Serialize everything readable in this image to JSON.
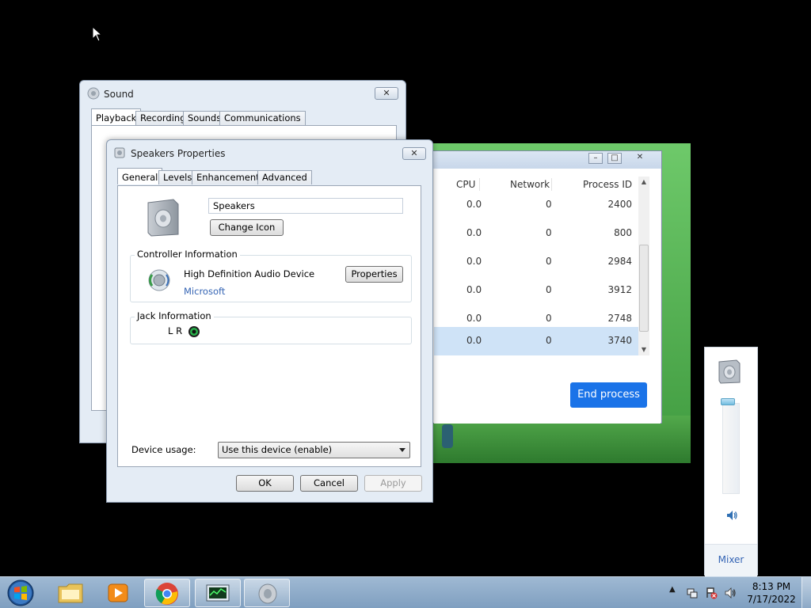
{
  "task_manager": {
    "columns": [
      "CPU",
      "Network",
      "Process ID"
    ],
    "rows": [
      {
        "cpu": "0.0",
        "network": "0",
        "pid": "2400"
      },
      {
        "cpu": "0.0",
        "network": "0",
        "pid": "800"
      },
      {
        "cpu": "0.0",
        "network": "0",
        "pid": "2984"
      },
      {
        "cpu": "0.0",
        "network": "0",
        "pid": "3912"
      },
      {
        "cpu": "0.0",
        "network": "0",
        "pid": "2748"
      },
      {
        "cpu": "0.0",
        "network": "0",
        "pid": "3740"
      }
    ],
    "selected_row_index": 5,
    "end_process_label": "End process"
  },
  "sound_dialog": {
    "title": "Sound",
    "tabs": [
      "Playback",
      "Recording",
      "Sounds",
      "Communications"
    ],
    "active_tab": "Playback",
    "close_glyph": "✕"
  },
  "speakers_dialog": {
    "title": "Speakers Properties",
    "tabs": [
      "General",
      "Levels",
      "Enhancements",
      "Advanced"
    ],
    "active_tab": "General",
    "device_name": "Speakers",
    "change_icon_label": "Change Icon",
    "controller_group_label": "Controller Information",
    "controller_name": "High Definition Audio Device",
    "controller_vendor": "Microsoft",
    "properties_label": "Properties",
    "jack_group_label": "Jack Information",
    "jack_channels": "L R",
    "device_usage_label": "Device usage:",
    "device_usage_value": "Use this device (enable)",
    "ok_label": "OK",
    "cancel_label": "Cancel",
    "apply_label": "Apply"
  },
  "volume_flyout": {
    "mixer_label": "Mixer",
    "level_fraction": 1.0
  },
  "taskbar": {
    "time": "8:13 PM",
    "date": "7/17/2022",
    "pinned": [
      "start-orb",
      "windows-explorer",
      "windows-media-player",
      "google-chrome",
      "task-manager",
      "sound"
    ]
  }
}
